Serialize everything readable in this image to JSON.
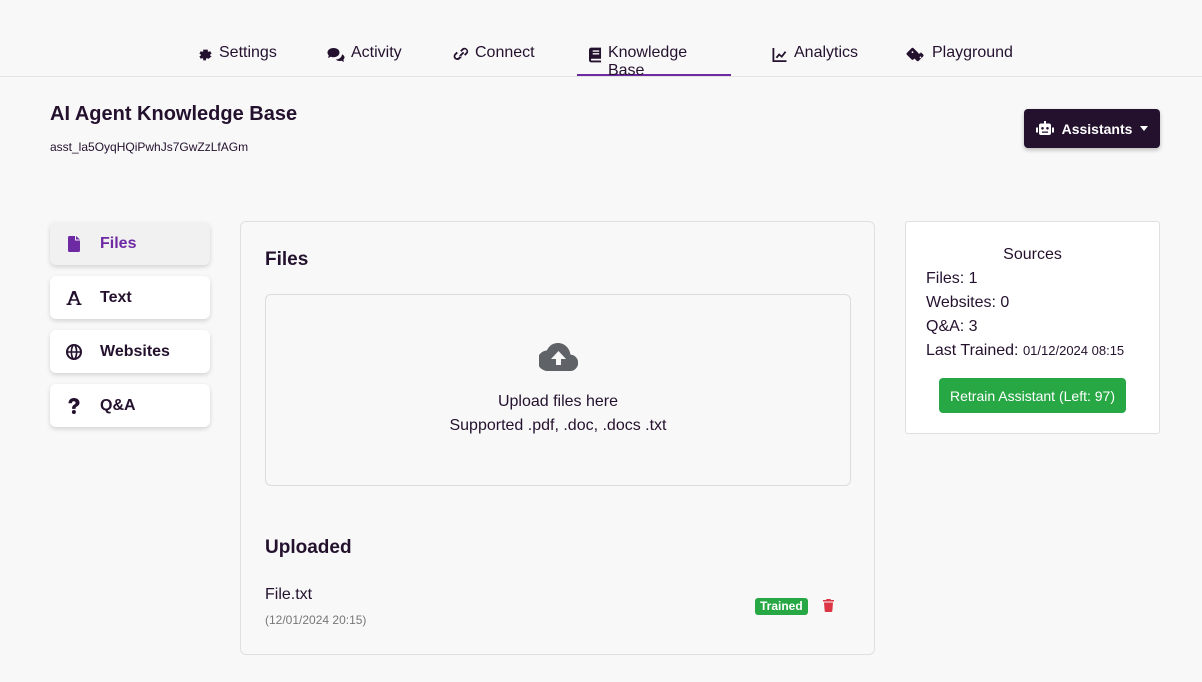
{
  "nav": {
    "tabs": [
      {
        "label": "Settings",
        "icon": "gear-icon"
      },
      {
        "label": "Activity",
        "icon": "comments-icon"
      },
      {
        "label": "Connect",
        "icon": "link-icon"
      },
      {
        "label": "Knowledge Base",
        "icon": "book-icon",
        "active": true
      },
      {
        "label": "Analytics",
        "icon": "chart-line-icon"
      },
      {
        "label": "Playground",
        "icon": "dice-icon"
      }
    ]
  },
  "header": {
    "title": "AI Agent Knowledge Base",
    "assistant_id": "asst_la5OyqHQiPwhJs7GwZzLfAGm",
    "assistants_label": "Assistants"
  },
  "sidebar": {
    "items": [
      {
        "label": "Files",
        "icon": "file-icon",
        "active": true
      },
      {
        "label": "Text",
        "icon": "text-icon"
      },
      {
        "label": "Websites",
        "icon": "globe-icon"
      },
      {
        "label": "Q&A",
        "icon": "question-icon"
      }
    ]
  },
  "files_panel": {
    "title": "Files",
    "upload_line1": "Upload files here",
    "upload_line2": "Supported .pdf, .doc, .docs .txt",
    "uploaded_title": "Uploaded",
    "uploaded": [
      {
        "name": "File.txt",
        "date": "(12/01/2024 20:15)",
        "status": "Trained"
      }
    ]
  },
  "sources": {
    "title": "Sources",
    "files": "Files: 1",
    "websites": "Websites: 0",
    "qa": "Q&A: 3",
    "last_trained_label": "Last Trained:",
    "last_trained_value": "01/12/2024 08:15",
    "retrain_label": "Retrain Assistant (Left: 97)"
  },
  "colors": {
    "primary": "#24112e",
    "accent": "#6e2aa3",
    "success": "#28a745",
    "danger": "#dc3545"
  }
}
